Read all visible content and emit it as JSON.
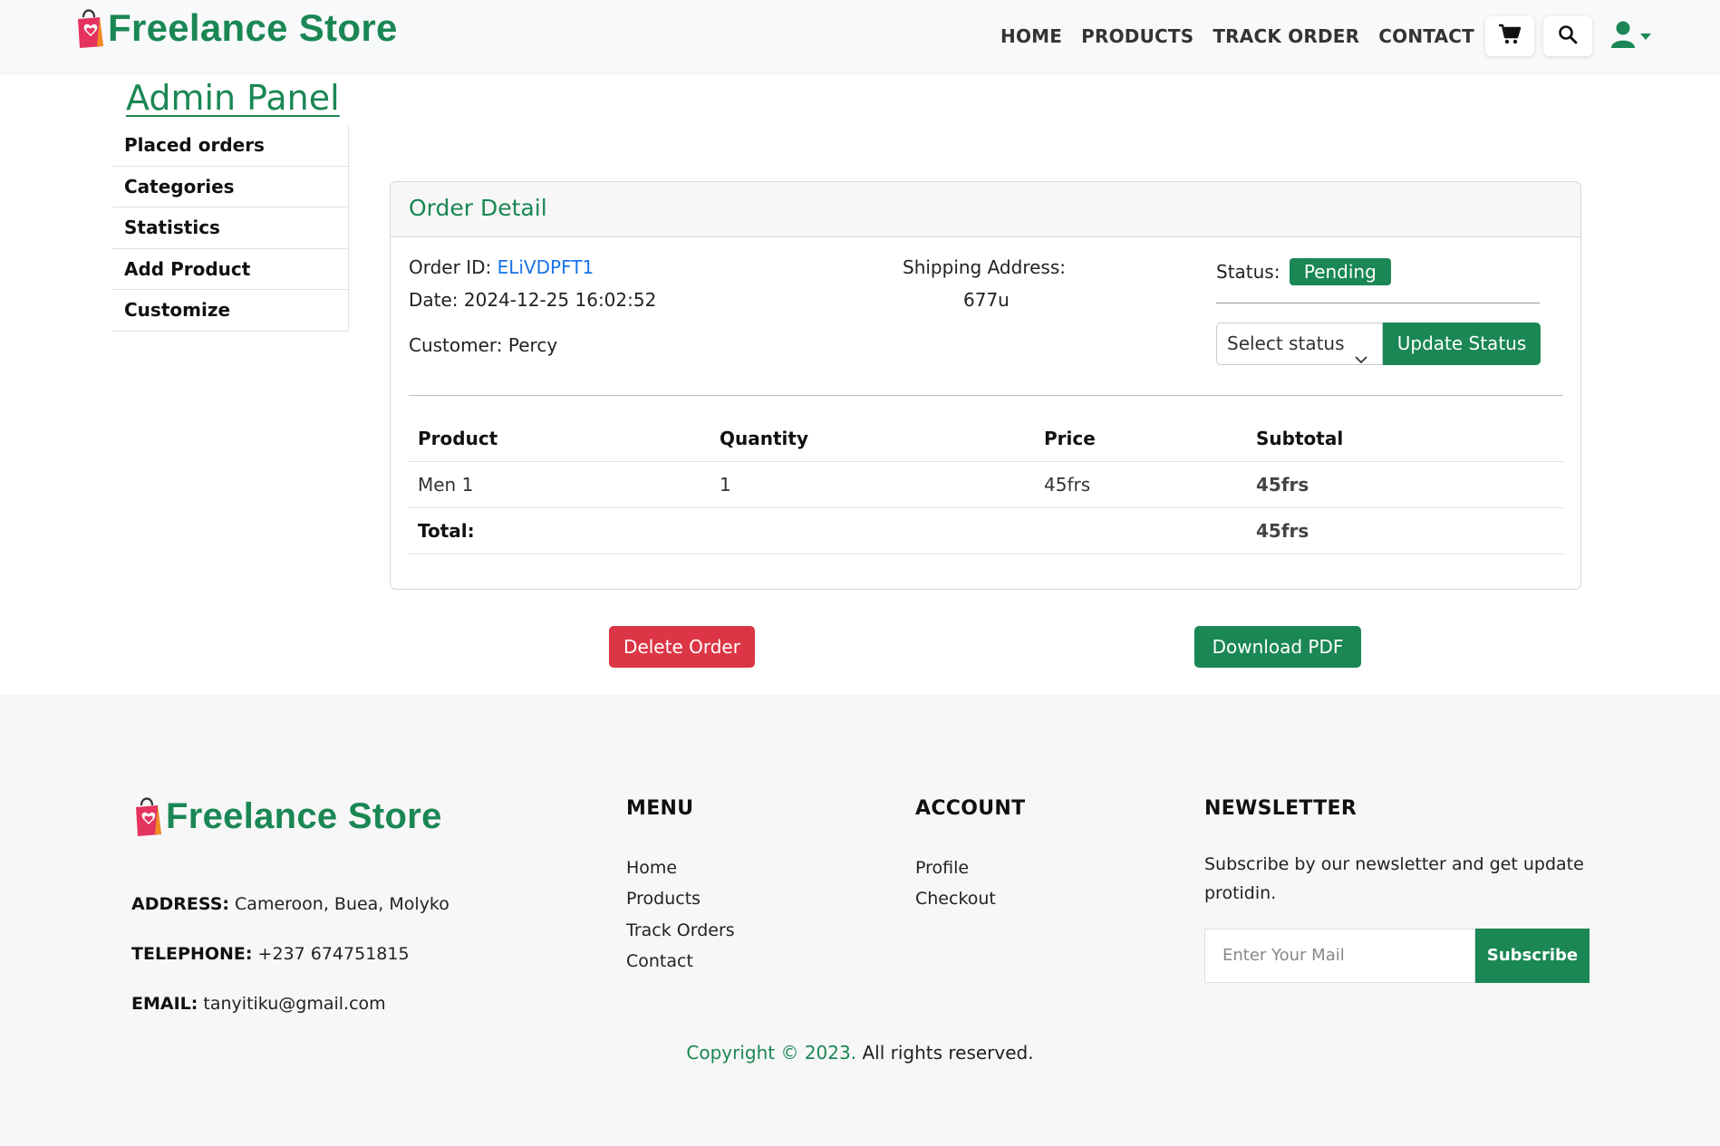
{
  "brand": {
    "name": "Freelance Store",
    "logo_icon": "shopping-bag-heart-icon",
    "color": "#1a8754"
  },
  "nav": {
    "links": [
      "HOME",
      "PRODUCTS",
      "TRACK ORDER",
      "CONTACT"
    ],
    "icons": [
      "cart-icon",
      "search-icon",
      "user-icon"
    ]
  },
  "admin": {
    "title": "Admin Panel",
    "sidebar": [
      "Placed orders",
      "Categories",
      "Statistics",
      "Add Product",
      "Customize"
    ]
  },
  "order": {
    "card_title": "Order Detail",
    "id_label": "Order ID:",
    "id_value": "ELiVDPFT1",
    "date_label": "Date:",
    "date_value": "2024-12-25 16:02:52",
    "customer_label": "Customer:",
    "customer_value": "Percy",
    "shipping_label": "Shipping Address:",
    "shipping_value": "677u",
    "status_label": "Status:",
    "status_value": "Pending",
    "select_placeholder": "Select status",
    "update_button": "Update Status",
    "table": {
      "headers": [
        "Product",
        "Quantity",
        "Price",
        "Subtotal"
      ],
      "rows": [
        [
          "Men 1",
          "1",
          "45frs",
          "45frs"
        ]
      ],
      "total_label": "Total:",
      "total_value": "45frs"
    },
    "delete_button": "Delete Order",
    "pdf_button": "Download PDF"
  },
  "footer": {
    "address_label": "ADDRESS:",
    "address_value": "Cameroon, Buea, Molyko",
    "telephone_label": "TELEPHONE:",
    "telephone_value": "+237 674751815",
    "email_label": "EMAIL:",
    "email_value": "tanyitiku@gmail.com",
    "menu_title": "MENU",
    "menu_links": [
      "Home",
      "Products",
      "Track Orders",
      "Contact"
    ],
    "account_title": "ACCOUNT",
    "account_links": [
      "Profile",
      "Checkout"
    ],
    "newsletter_title": "NEWSLETTER",
    "newsletter_text": "Subscribe by our newsletter and get update protidin.",
    "email_placeholder": "Enter Your Mail",
    "subscribe_button": "Subscribe",
    "copyright_green": "Copyright © 2023.",
    "copyright_rest": " All rights reserved."
  }
}
